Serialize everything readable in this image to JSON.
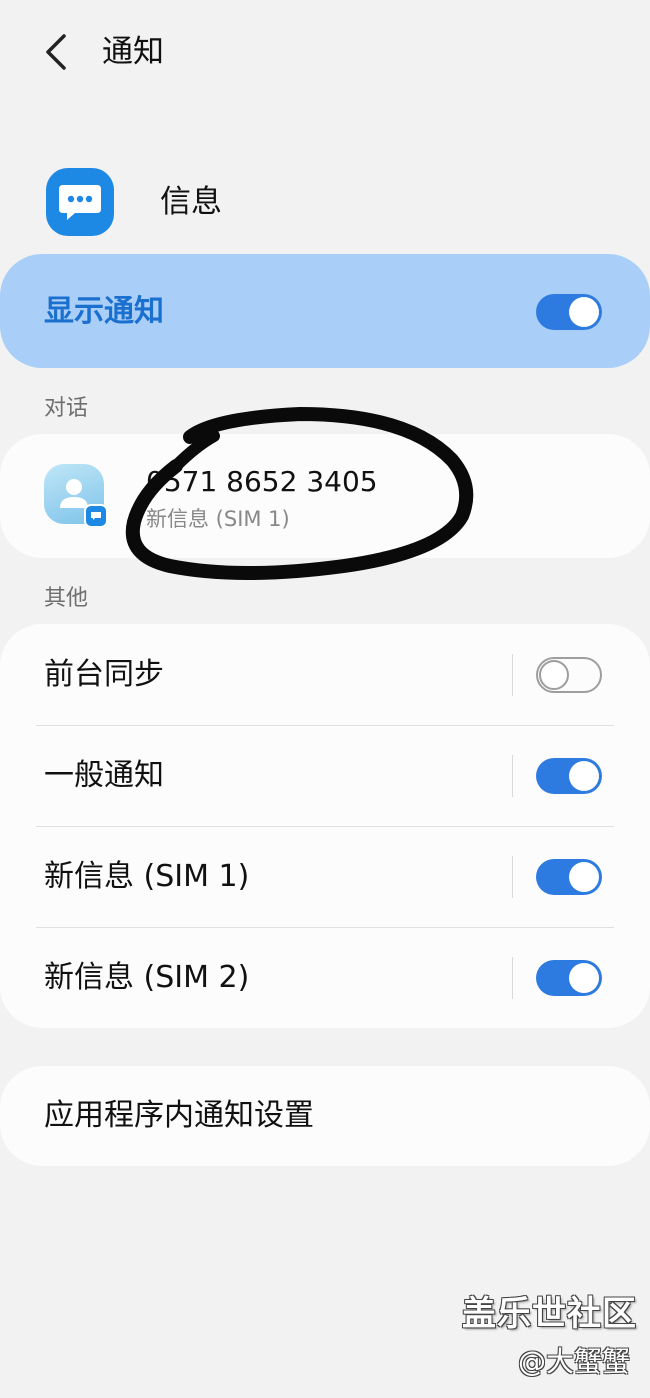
{
  "header": {
    "title": "通知"
  },
  "app": {
    "name": "信息",
    "icon": "message-bubble-icon"
  },
  "show_notifications": {
    "label": "显示通知",
    "enabled": true
  },
  "conversations": {
    "section_label": "对话",
    "items": [
      {
        "number": "0571 8652 3405",
        "subtitle": "新信息 (SIM 1)"
      }
    ]
  },
  "other": {
    "section_label": "其他",
    "items": [
      {
        "label": "前台同步",
        "enabled": false
      },
      {
        "label": "一般通知",
        "enabled": true
      },
      {
        "label": "新信息 (SIM 1)",
        "enabled": true
      },
      {
        "label": "新信息 (SIM 2)",
        "enabled": true
      }
    ]
  },
  "in_app_settings": {
    "label": "应用程序内通知设置"
  },
  "watermark": {
    "title": "盖乐世社区",
    "handle": "@大蟹蟹"
  },
  "colors": {
    "accent": "#2d7be0",
    "highlight_card": "#a9cff8",
    "background": "#f2f2f2"
  }
}
